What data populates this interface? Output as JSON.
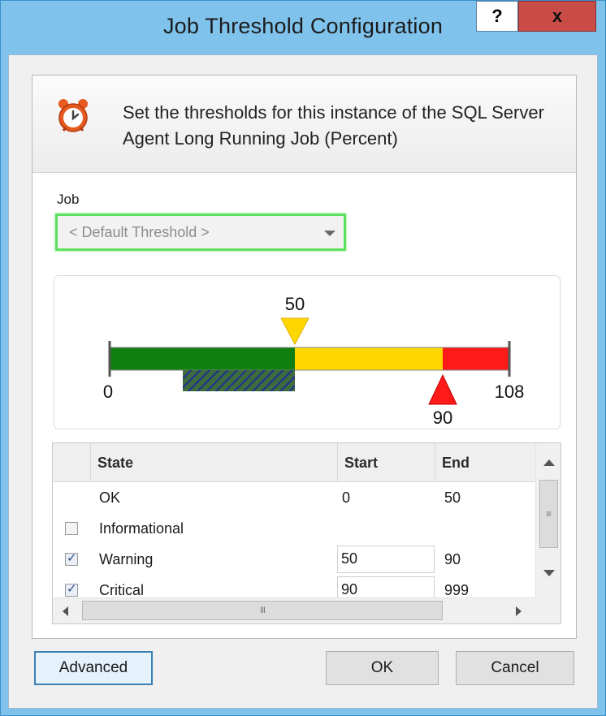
{
  "window": {
    "title": "Job Threshold Configuration",
    "help_label": "?",
    "close_label": "x"
  },
  "header": {
    "description": "Set the thresholds for this instance of the SQL Server Agent Long Running Job (Percent)",
    "icon": "alarm-clock-icon"
  },
  "job": {
    "label": "Job",
    "selected": "< Default Threshold >"
  },
  "scale": {
    "min": "0",
    "max": "108",
    "warning_marker": "50",
    "critical_marker": "90",
    "colors": {
      "ok": "#0f7f0f",
      "warning": "#ffd700",
      "critical": "#ff1a1a",
      "baseline": "#3f5f3f"
    }
  },
  "grid": {
    "columns": {
      "state": "State",
      "start": "Start",
      "end": "End"
    },
    "rows": [
      {
        "checkbox": false,
        "show_checkbox": false,
        "state": "OK",
        "start": "0",
        "end": "50",
        "editable": false
      },
      {
        "checkbox": false,
        "show_checkbox": true,
        "state": "Informational",
        "start": "",
        "end": "",
        "editable": false
      },
      {
        "checkbox": true,
        "show_checkbox": true,
        "state": "Warning",
        "start": "50",
        "end": "90",
        "editable": true
      },
      {
        "checkbox": true,
        "show_checkbox": true,
        "state": "Critical",
        "start": "90",
        "end": "999",
        "editable": true
      }
    ],
    "scroll_grip": "III",
    "vscroll_grip": "≡"
  },
  "buttons": {
    "advanced": "Advanced",
    "ok": "OK",
    "cancel": "Cancel"
  }
}
